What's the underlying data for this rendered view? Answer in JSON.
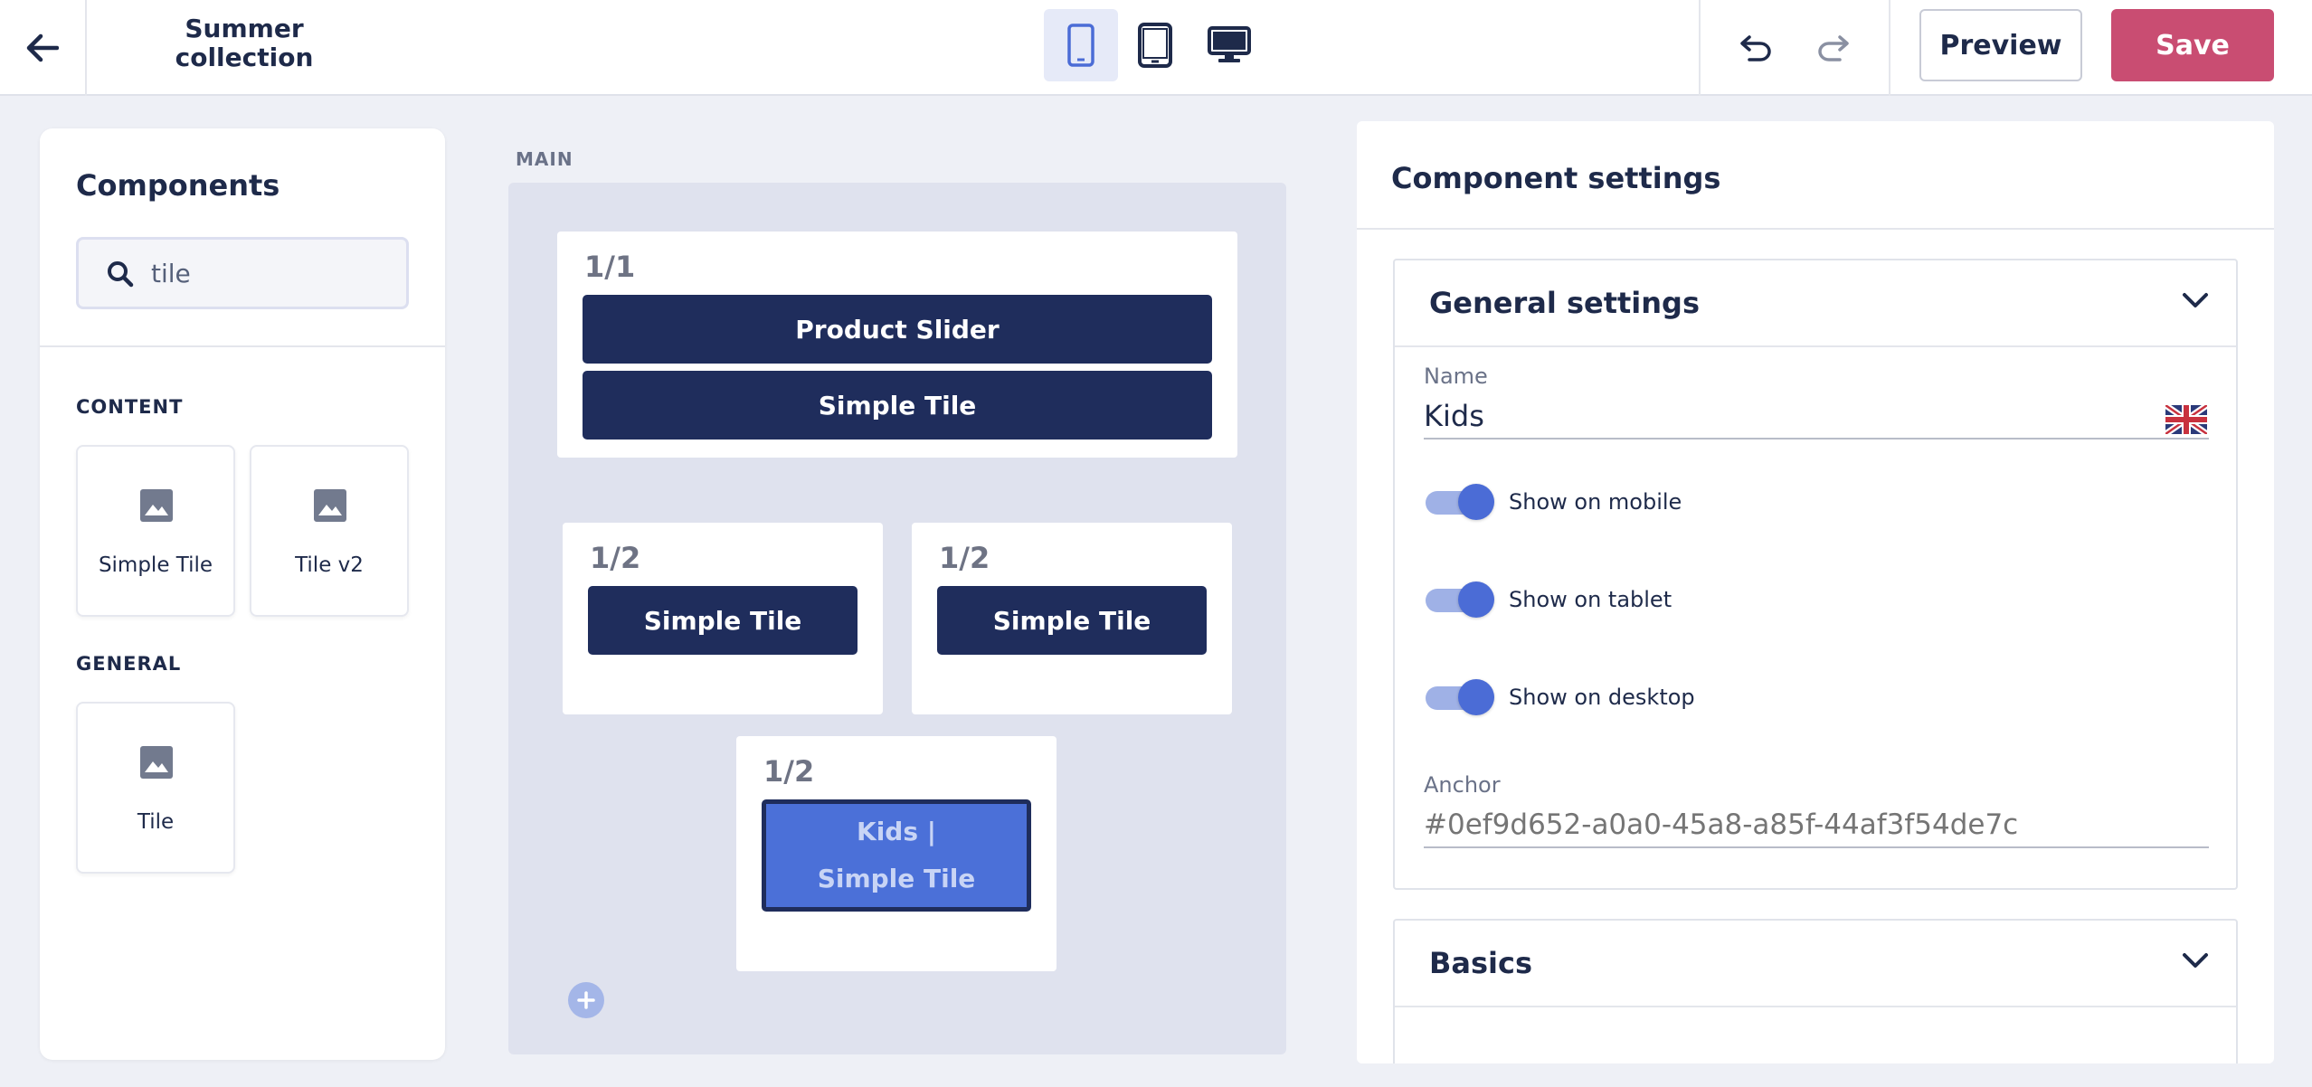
{
  "header": {
    "title": "Summer collection",
    "preview_label": "Preview",
    "save_label": "Save",
    "devices": [
      "mobile",
      "tablet",
      "desktop"
    ],
    "active_device": "mobile"
  },
  "components_panel": {
    "title": "Components",
    "search_value": "tile",
    "groups": [
      {
        "label": "CONTENT",
        "items": [
          "Simple Tile",
          "Tile v2"
        ]
      },
      {
        "label": "GENERAL",
        "items": [
          "Tile"
        ]
      }
    ]
  },
  "canvas": {
    "label": "MAIN",
    "sections": [
      {
        "fraction": "1/1",
        "blocks": [
          "Product Slider",
          "Simple Tile"
        ]
      },
      {
        "fraction": "1/2",
        "blocks": [
          "Simple Tile"
        ]
      },
      {
        "fraction": "1/2",
        "blocks": [
          "Simple Tile"
        ]
      },
      {
        "fraction": "1/2",
        "selected_block": {
          "line1": "Kids |",
          "line2": "Simple Tile"
        }
      }
    ]
  },
  "settings_panel": {
    "title": "Component settings",
    "general": {
      "title": "General settings",
      "name_label": "Name",
      "name_value": "Kids",
      "toggles": [
        {
          "label": "Show on mobile",
          "on": true
        },
        {
          "label": "Show on tablet",
          "on": true
        },
        {
          "label": "Show on desktop",
          "on": true
        }
      ],
      "anchor_label": "Anchor",
      "anchor_placeholder": "#0ef9d652-a0a0-45a8-a85f-44af3f54de7c"
    },
    "basics_title": "Basics"
  },
  "colors": {
    "accent": "#4b6cd6",
    "block": "#1f2d5c",
    "save": "#c94d72"
  }
}
